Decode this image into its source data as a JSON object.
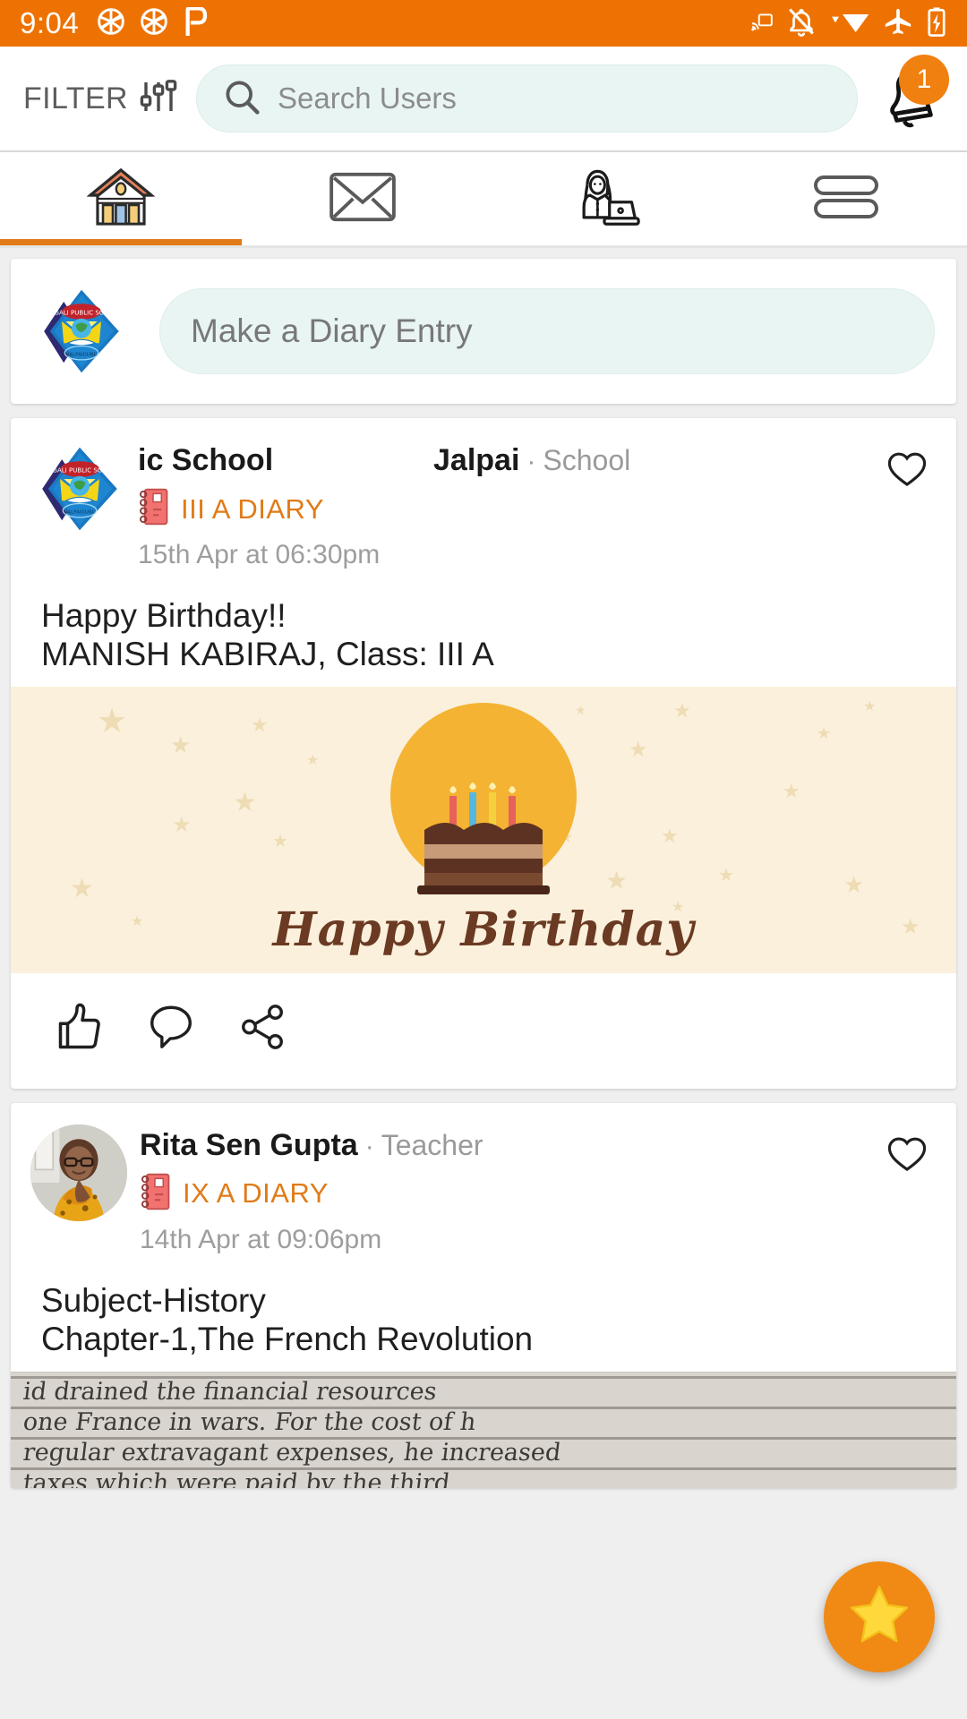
{
  "status_bar": {
    "time": "9:04",
    "left_icons": [
      "aperture-icon",
      "aperture-icon",
      "pocket-casts-icon"
    ],
    "right_icons": [
      "cast-icon",
      "notifications-off-icon",
      "wifi-icon",
      "airplane-mode-icon",
      "battery-charging-icon"
    ],
    "background_color": "#EE7202"
  },
  "header": {
    "filter_label": "FILTER",
    "filter_icon": "sliders-icon",
    "search": {
      "placeholder": "Search Users",
      "value": "",
      "icon": "search-icon"
    },
    "notification": {
      "icon": "bell-icon",
      "badge_count": "1",
      "badge_color": "#F08010"
    }
  },
  "tabs": [
    {
      "name": "home",
      "icon": "home-icon",
      "active": true
    },
    {
      "name": "messages",
      "icon": "envelope-icon",
      "active": false
    },
    {
      "name": "classroom",
      "icon": "teacher-laptop-icon",
      "active": false
    },
    {
      "name": "menu",
      "icon": "hamburger-menu-icon",
      "active": false
    }
  ],
  "tab_indicator_color": "#E07B18",
  "compose": {
    "avatar": "school-logo-icon",
    "placeholder": "Make a Diary Entry"
  },
  "posts": [
    {
      "avatar": "school-logo-icon",
      "avatar_type": "logo",
      "author": "ic School",
      "location": "Jalpai",
      "role": "School",
      "diary_icon": "notebook-icon",
      "diary_tag": "III A DIARY",
      "timestamp": "15th Apr at 06:30pm",
      "like_icon": "heart-icon",
      "body_lines": [
        "Happy Birthday!!",
        "MANISH KABIRAJ, Class: III A"
      ],
      "image": {
        "type": "birthday-card",
        "caption": "Happy Birthday",
        "background_color": "#FAF0DC",
        "circle_color": "#F4B333",
        "caption_color": "#6B3A22"
      },
      "actions": [
        "thumbs-up-icon",
        "comment-icon",
        "share-icon"
      ]
    },
    {
      "avatar": "teacher-photo",
      "avatar_type": "photo",
      "author": "Rita Sen Gupta",
      "location": "",
      "role": "Teacher",
      "diary_icon": "notebook-icon",
      "diary_tag": "IX A DIARY",
      "timestamp": "14th Apr at 09:06pm",
      "like_icon": "heart-icon",
      "body_lines": [
        "Subject-History",
        "Chapter-1,The French Revolution"
      ],
      "image": {
        "type": "handwritten-notes",
        "lines": [
          "id      drained the financial resources",
          "one     France in wars. For the cost of h",
          "regular extravagant expenses, he increased",
          "taxes which were paid by the third"
        ]
      },
      "actions": []
    }
  ],
  "fab": {
    "icon": "star-icon",
    "background_color": "#F08A15"
  }
}
